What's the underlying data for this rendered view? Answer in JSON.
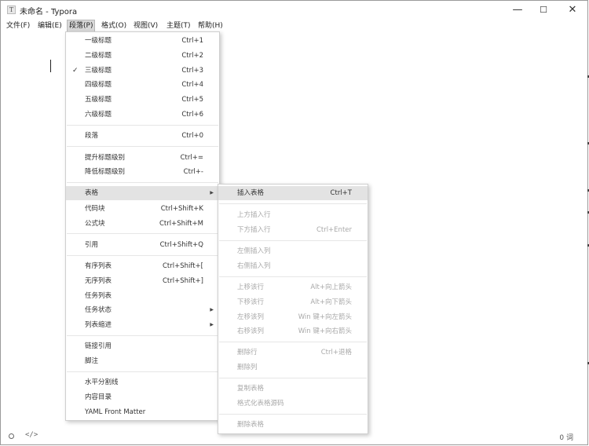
{
  "window": {
    "title": "未命名 - Typora",
    "app_icon_letter": "T",
    "controls": {
      "minimize": "—",
      "maximize": "☐",
      "close": "✕"
    }
  },
  "menubar": [
    "文件(F)",
    "编辑(E)",
    "段落(P)",
    "格式(O)",
    "视图(V)",
    "主题(T)",
    "帮助(H)"
  ],
  "menubar_active": "段落(P)",
  "paragraph_menu": {
    "headings": [
      {
        "label": "一级标题",
        "shortcut": "Ctrl+1"
      },
      {
        "label": "二级标题",
        "shortcut": "Ctrl+2"
      },
      {
        "label": "三级标题",
        "shortcut": "Ctrl+3",
        "checked": true
      },
      {
        "label": "四级标题",
        "shortcut": "Ctrl+4"
      },
      {
        "label": "五级标题",
        "shortcut": "Ctrl+5"
      },
      {
        "label": "六级标题",
        "shortcut": "Ctrl+6"
      }
    ],
    "check_glyph": "✓",
    "paragraph": {
      "label": "段落",
      "shortcut": "Ctrl+0"
    },
    "promote": {
      "label": "提升标题级别",
      "shortcut": "Ctrl+="
    },
    "demote": {
      "label": "降低标题级别",
      "shortcut": "Ctrl+-"
    },
    "table": {
      "label": "表格"
    },
    "code_block": {
      "label": "代码块",
      "shortcut": "Ctrl+Shift+K"
    },
    "math_block": {
      "label": "公式块",
      "shortcut": "Ctrl+Shift+M"
    },
    "quote": {
      "label": "引用",
      "shortcut": "Ctrl+Shift+Q"
    },
    "ordered_list": {
      "label": "有序列表",
      "shortcut": "Ctrl+Shift+["
    },
    "unordered_list": {
      "label": "无序列表",
      "shortcut": "Ctrl+Shift+]"
    },
    "task_list": {
      "label": "任务列表"
    },
    "task_status": {
      "label": "任务状态"
    },
    "list_indent": {
      "label": "列表缩进"
    },
    "link_reference": {
      "label": "链接引用"
    },
    "footnote": {
      "label": "脚注"
    },
    "horizontal_rule": {
      "label": "水平分割线"
    },
    "toc": {
      "label": "内容目录"
    },
    "yaml": {
      "label": "YAML Front Matter"
    },
    "arrow_glyph": "▶"
  },
  "table_submenu": {
    "insert_table": {
      "label": "插入表格",
      "shortcut": "Ctrl+T"
    },
    "row_above": {
      "label": "上方插入行"
    },
    "row_below": {
      "label": "下方插入行",
      "shortcut": "Ctrl+Enter"
    },
    "col_left": {
      "label": "左侧插入列"
    },
    "col_right": {
      "label": "右侧插入列"
    },
    "move_row_up": {
      "label": "上移该行",
      "shortcut": "Alt+向上箭头"
    },
    "move_row_down": {
      "label": "下移该行",
      "shortcut": "Alt+向下箭头"
    },
    "move_col_left": {
      "label": "左移该列",
      "shortcut": "Win 键+向左箭头"
    },
    "move_col_right": {
      "label": "右移该列",
      "shortcut": "Win 键+向右箭头"
    },
    "delete_row": {
      "label": "删除行",
      "shortcut": "Ctrl+退格"
    },
    "delete_col": {
      "label": "删除列"
    },
    "copy_table": {
      "label": "复制表格"
    },
    "format_source": {
      "label": "格式化表格源码"
    },
    "delete_table": {
      "label": "删除表格"
    }
  },
  "statusbar": {
    "outline_icon": "circle-icon",
    "source_icon_glyph": "</>",
    "word_count": "0 词"
  }
}
